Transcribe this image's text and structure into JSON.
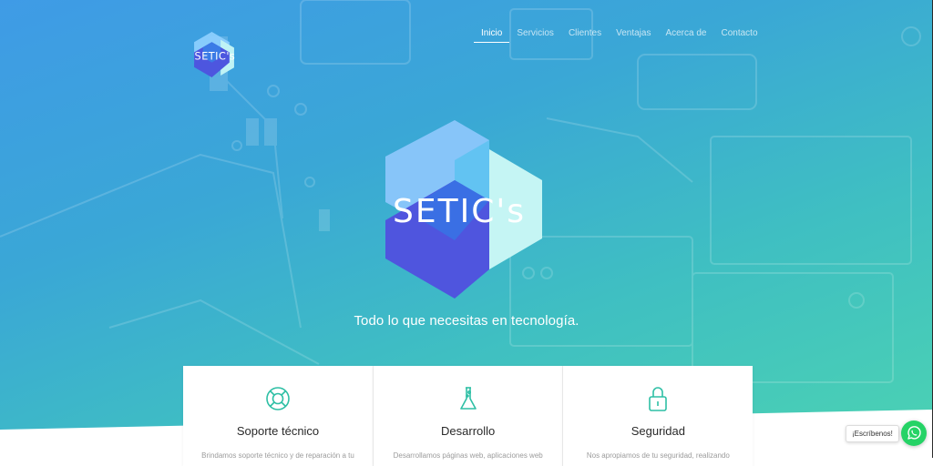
{
  "brand": {
    "logo_text": "SETIC's"
  },
  "nav": {
    "items": [
      {
        "label": "Inicio",
        "active": true
      },
      {
        "label": "Servicios"
      },
      {
        "label": "Clientes"
      },
      {
        "label": "Ventajas"
      },
      {
        "label": "Acerca de"
      },
      {
        "label": "Contacto"
      }
    ]
  },
  "hero": {
    "tagline": "Todo lo que necesitas en tecnología."
  },
  "services": [
    {
      "title": "Soporte técnico",
      "icon": "lifebuoy-icon",
      "desc": "Brindamos soporte técnico y de reparación a tu"
    },
    {
      "title": "Desarrollo",
      "icon": "flask-icon",
      "desc": "Desarrollamos páginas web, aplicaciones web"
    },
    {
      "title": "Seguridad",
      "icon": "lock-icon",
      "desc": "Nos apropiamos de tu seguridad, realizando"
    }
  ],
  "chat": {
    "label": "¡Escríbenos!",
    "icon": "whatsapp-icon"
  },
  "colors": {
    "gradient_start": "#3f9be6",
    "gradient_end": "#4cd3b2",
    "accent": "#2ebfa5",
    "whatsapp": "#25d366"
  }
}
